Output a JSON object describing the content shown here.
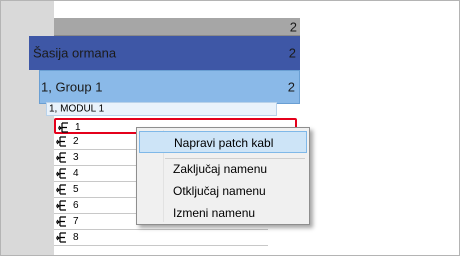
{
  "header": {
    "count": "2"
  },
  "sasija": {
    "label": "Šasija ormana",
    "count": "2"
  },
  "group": {
    "label": "1, Group 1",
    "count": "2"
  },
  "modul": {
    "label": "1, MODUL 1"
  },
  "ports": [
    {
      "label": "1",
      "selected": true,
      "icon": "port-icon"
    },
    {
      "label": "2",
      "icon": "port-icon"
    },
    {
      "label": "3",
      "icon": "port-icon"
    },
    {
      "label": "4",
      "icon": "port-icon"
    },
    {
      "label": "5",
      "icon": "port-icon"
    },
    {
      "label": "6",
      "icon": "port-icon"
    },
    {
      "label": "7",
      "icon": "port-icon"
    },
    {
      "label": "8",
      "icon": "port-icon"
    }
  ],
  "context_menu": {
    "items": [
      {
        "label": "Napravi patch kabl",
        "highlighted": true
      },
      {
        "label": "Zaključaj namenu"
      },
      {
        "label": "Otključaj namenu"
      },
      {
        "label": "Izmeni namenu"
      }
    ]
  },
  "colors": {
    "sasija_band": "#3e57a6",
    "group_band": "#8ab9e8",
    "selection_outline": "#e4001b"
  }
}
